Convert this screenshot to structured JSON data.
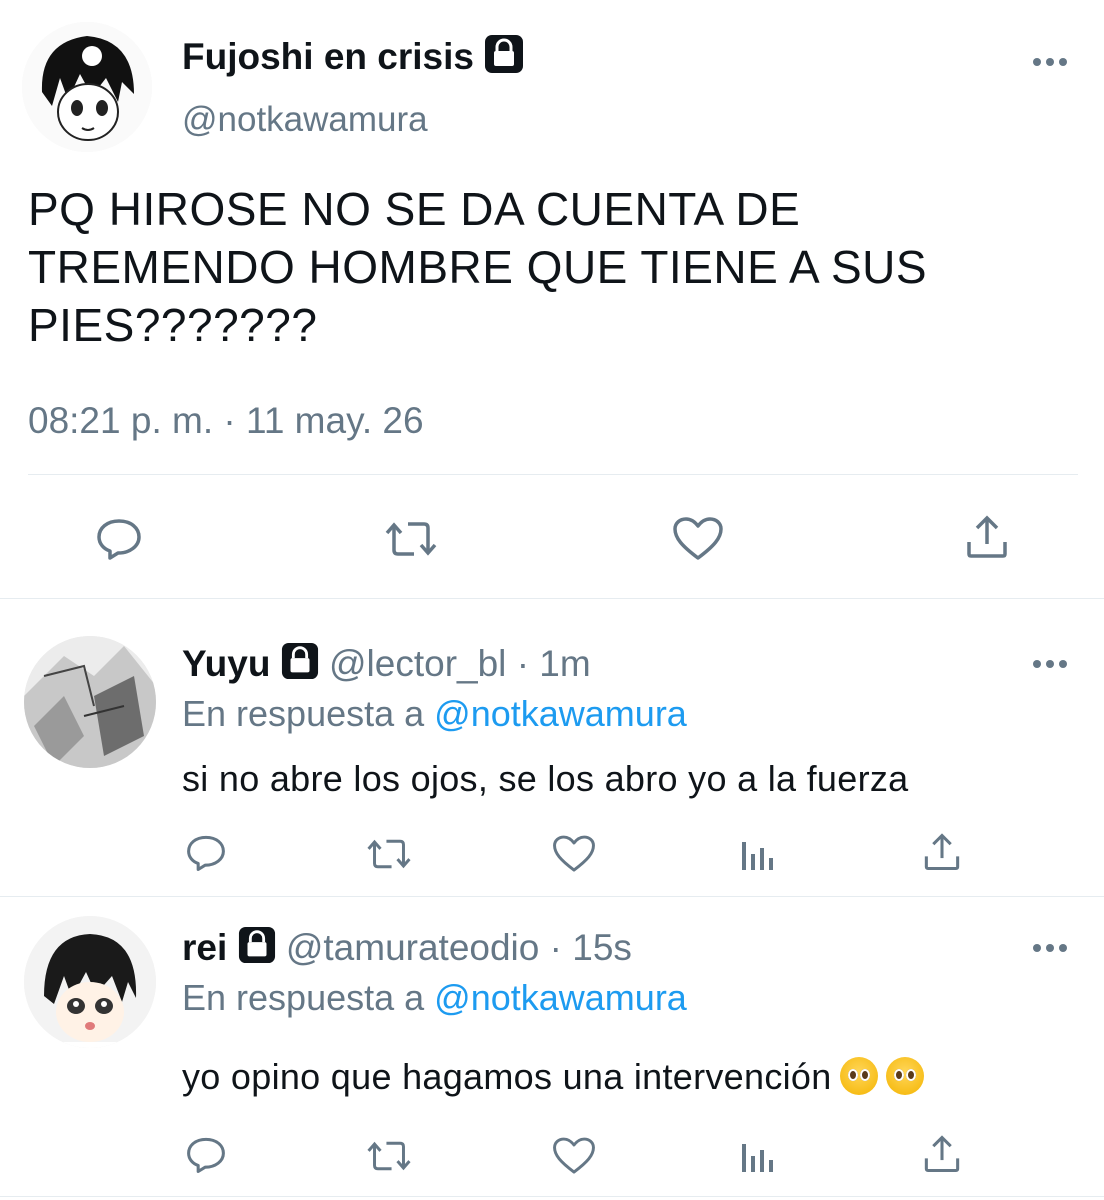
{
  "main_tweet": {
    "display_name": "Fujoshi en crisis",
    "handle": "@notkawamura",
    "text_lines": [
      "PQ HIROSE NO SE DA CUENTA DE",
      "TREMENDO HOMBRE QUE TIENE A SUS",
      "PIES???????"
    ],
    "timestamp": "08:21 p. m. · 11 may. 26"
  },
  "replies": [
    {
      "display_name": "Yuyu",
      "handle": "@lector_bl",
      "time": "· 1m",
      "reply_prefix": "En respuesta a",
      "reply_to": "@notkawamura",
      "text": "si no abre los ojos, se los abro yo a la fuerza"
    },
    {
      "display_name": "rei",
      "handle": "@tamurateodio",
      "time": "· 15s",
      "reply_prefix": "En respuesta a",
      "reply_to": "@notkawamura",
      "text": "yo opino que hagamos una intervención"
    }
  ],
  "icons": {
    "lock": "lock-icon",
    "more": "more-options-icon",
    "reply": "reply-icon",
    "retweet": "retweet-icon",
    "like": "like-icon",
    "share": "share-icon",
    "analytics": "analytics-icon",
    "emoji": "pleading-face-emoji"
  },
  "colors": {
    "link": "#1d9bf0",
    "muted": "#657786",
    "text": "#0f1419",
    "divider": "#e6ecf0"
  }
}
